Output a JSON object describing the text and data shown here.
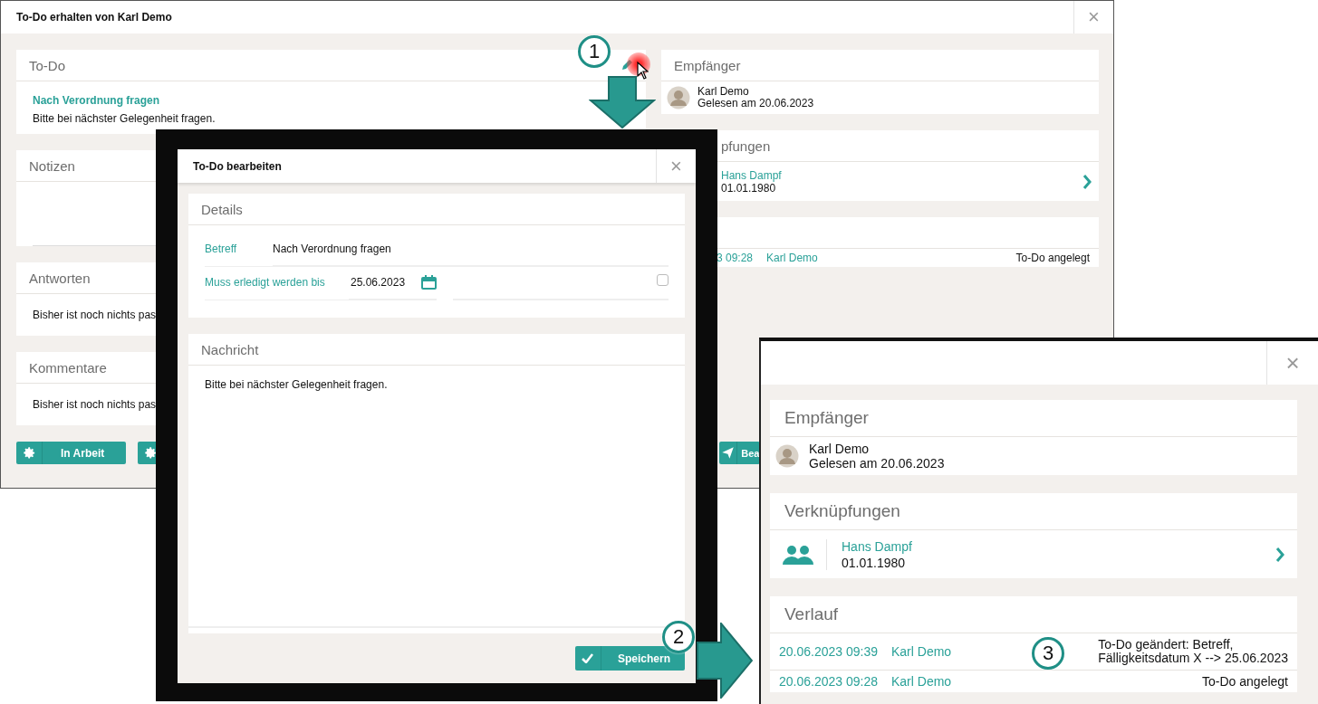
{
  "main_window": {
    "title": "To-Do erhalten von Karl Demo",
    "close": "×",
    "cards": [
      {
        "kind": "todo",
        "heading": "To-Do",
        "subject": "Nach Verordnung fragen",
        "text": "Bitte bei nächster Gelegenheit fragen."
      },
      {
        "kind": "notes",
        "heading": "Notizen"
      },
      {
        "kind": "text",
        "heading": "Antworten",
        "text": "Bisher ist noch nichts pas"
      },
      {
        "kind": "text",
        "heading": "Kommentare",
        "text": "Bisher ist noch nichts pas"
      }
    ],
    "buttons": [
      {
        "kind": "gear",
        "label": "In Arbeit"
      },
      {
        "kind": "gear"
      },
      {
        "kind": "send",
        "label": "Bea"
      }
    ],
    "recipient": {
      "heading": "Empfänger",
      "name": "Karl Demo",
      "status": "Gelesen am 20.06.2023"
    },
    "links": {
      "heading": "pfungen",
      "name": "Hans Dampf",
      "date": "01.01.1980"
    },
    "history": {
      "rows": [
        {
          "time": "3 09:28",
          "user": "Karl Demo",
          "action": "To-Do angelegt"
        }
      ]
    }
  },
  "edit_dialog": {
    "title": "To-Do bearbeiten",
    "close": "×",
    "details": {
      "heading": "Details",
      "fields": [
        {
          "kind": "text",
          "label": "Betreff",
          "value": "Nach Verordnung fragen"
        },
        {
          "kind": "date",
          "label": "Muss erledigt werden bis",
          "value": "25.06.2023",
          "checked": false
        }
      ]
    },
    "message": {
      "heading": "Nachricht",
      "text": "Bitte bei nächster Gelegenheit fragen."
    },
    "save_button": "Speichern"
  },
  "result_window": {
    "close": "×",
    "recipient": {
      "heading": "Empfänger",
      "name": "Karl Demo",
      "status": "Gelesen am 20.06.2023"
    },
    "links": {
      "heading": "Verknüpfungen",
      "name": "Hans Dampf",
      "date": "01.01.1980"
    },
    "history": {
      "heading": "Verlauf",
      "rows": [
        {
          "time": "20.06.2023 09:39",
          "user": "Karl Demo",
          "action": "To-Do geändert: Betreff,\nFälligkeitsdatum X --> 25.06.2023"
        },
        {
          "time": "20.06.2023 09:28",
          "user": "Karl Demo",
          "action": "To-Do angelegt"
        }
      ]
    }
  },
  "callouts": [
    "1",
    "2",
    "3"
  ]
}
